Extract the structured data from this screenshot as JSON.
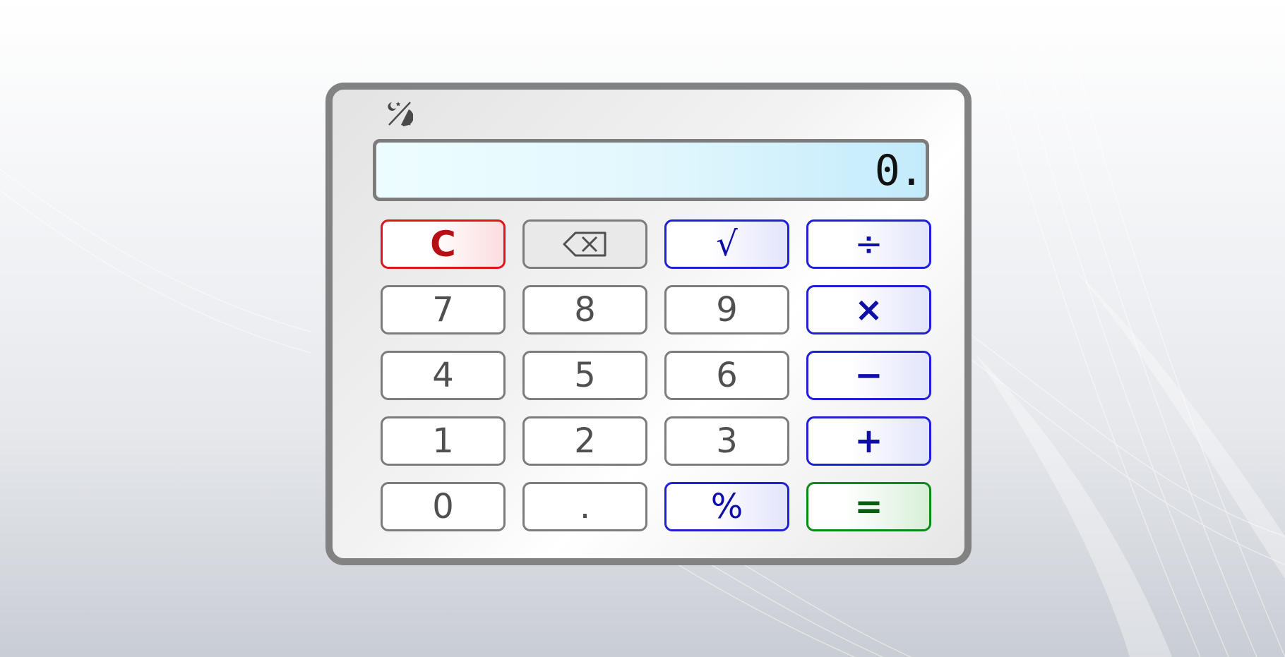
{
  "display": {
    "value": "0."
  },
  "theme_toggle": {
    "icon": "day-night-toggle-icon"
  },
  "keys": {
    "clear": "C",
    "backspace_icon": "backspace-icon",
    "sqrt": "√",
    "divide": "÷",
    "multiply": "×",
    "subtract": "−",
    "add": "+",
    "percent": "%",
    "equals": "=",
    "decimal": ".",
    "digits": {
      "d0": "0",
      "d1": "1",
      "d2": "2",
      "d3": "3",
      "d4": "4",
      "d5": "5",
      "d6": "6",
      "d7": "7",
      "d8": "8",
      "d9": "9"
    }
  },
  "colors": {
    "clear_accent": "#e0141c",
    "operator_accent": "#1f1fd6",
    "equals_accent": "#0c8a16",
    "display_bg": "#c3ebfb",
    "frame": "#828282"
  }
}
